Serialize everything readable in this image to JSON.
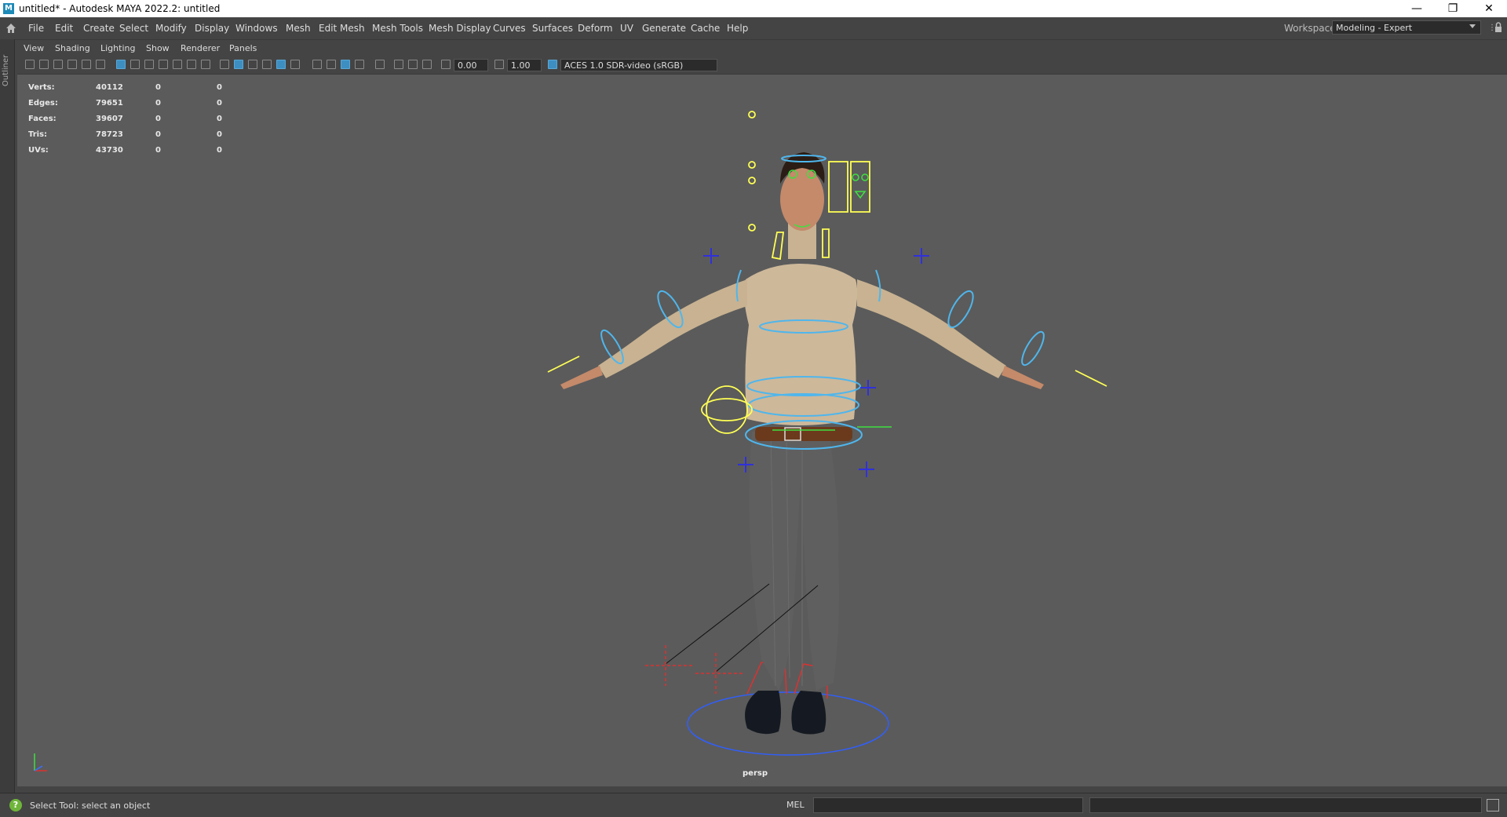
{
  "window": {
    "title": "untitled* - Autodesk MAYA 2022.2: untitled",
    "logo_letter": "M",
    "minimize_glyph": "—",
    "restore_glyph": "❐",
    "close_glyph": "✕"
  },
  "menubar": {
    "items": [
      "File",
      "Edit",
      "Create",
      "Select",
      "Modify",
      "Display",
      "Windows",
      "Mesh",
      "Edit Mesh",
      "Mesh Tools",
      "Mesh Display",
      "Curves",
      "Surfaces",
      "Deform",
      "UV",
      "Generate",
      "Cache",
      "Help"
    ],
    "workspace_label": "Workspace:",
    "workspace_value": "Modeling - Expert",
    "more_glyph": "⋮"
  },
  "sidebar": {
    "outliner_label": "Outliner"
  },
  "panel_menu": {
    "items": [
      "View",
      "Shading",
      "Lighting",
      "Show",
      "Renderer",
      "Panels"
    ]
  },
  "viewport_toolbar": {
    "exposure_value": "0.00",
    "gamma_value": "1.00",
    "color_space": "ACES 1.0 SDR-video (sRGB)"
  },
  "hud": {
    "rows": [
      {
        "label": "Verts:",
        "v1": "40112",
        "v2": "0",
        "v3": "0"
      },
      {
        "label": "Edges:",
        "v1": "79651",
        "v2": "0",
        "v3": "0"
      },
      {
        "label": "Faces:",
        "v1": "39607",
        "v2": "0",
        "v3": "0"
      },
      {
        "label": "Tris:",
        "v1": "78723",
        "v2": "0",
        "v3": "0"
      },
      {
        "label": "UVs:",
        "v1": "43730",
        "v2": "0",
        "v3": "0"
      }
    ]
  },
  "viewport": {
    "camera_name": "persp"
  },
  "colors": {
    "viewport_bg": "#5b5b5b",
    "ui_bg": "#444444",
    "control_blue": "#4fb6ec",
    "control_yellow": "#ffff55",
    "control_red": "#e03030",
    "control_green": "#40e040",
    "sweater": "#cdb89a",
    "pants": "#5f5f60",
    "skin": "#c48a6a"
  },
  "status": {
    "help_glyph": "?",
    "message": "Select Tool: select an object",
    "mel_label": "MEL"
  }
}
